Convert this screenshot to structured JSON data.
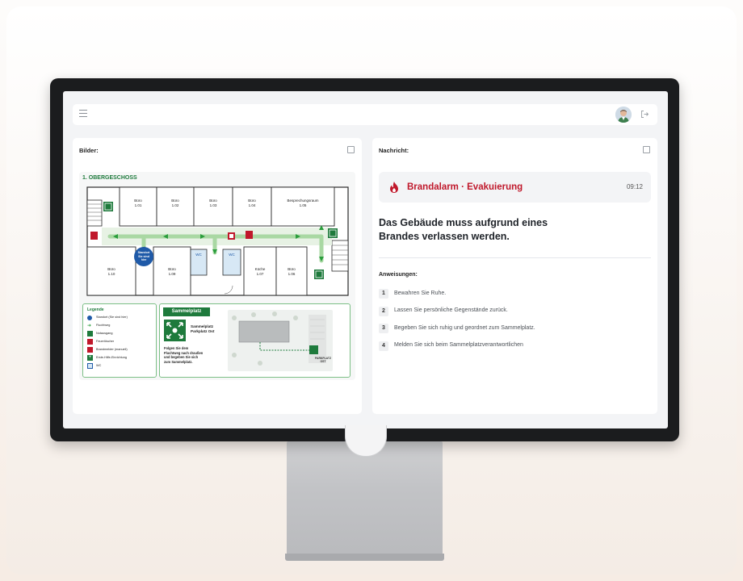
{
  "header": {
    "menu_icon": "hamburger-icon",
    "avatar_icon": "user-avatar",
    "logout_icon": "logout-icon"
  },
  "images_panel": {
    "title": "Bilder:",
    "plan": {
      "title": "1. OBERGESCHOSS",
      "rooms_top": [
        {
          "name": "Büro",
          "num": "1.01"
        },
        {
          "name": "Büro",
          "num": "1.02"
        },
        {
          "name": "Büro",
          "num": "1.03"
        },
        {
          "name": "Büro",
          "num": "1.04"
        },
        {
          "name": "Besprechungsraum",
          "num": "1.05"
        }
      ],
      "rooms_bottom": [
        {
          "name": "Büro",
          "num": "1.10"
        },
        {
          "name": "Büro",
          "num": "1.09"
        },
        {
          "name": "WC",
          "num": ""
        },
        {
          "name": "WC",
          "num": ""
        },
        {
          "name": "Küche",
          "num": "1.07"
        },
        {
          "name": "Büro",
          "num": "1.06"
        }
      ],
      "standort": [
        "Standort",
        "Sie sind",
        "hier"
      ],
      "legend": {
        "title": "Legende",
        "items": [
          "Standort (Sie sind hier)",
          "Fluchtweg",
          "Notausgang",
          "Feuerlöscher",
          "Brandmelder (manuell)",
          "Erste-Hilfe-Einrichtung",
          "WC"
        ]
      },
      "sammelplatz": {
        "title": "Sammelplatz",
        "name": [
          "Sammelplatz",
          "Parkplatz Ost"
        ],
        "desc": [
          "Folgen Sie dem",
          "Fluchtweg nach draußen",
          "und begeben Sie sich",
          "zum Sammelplatz."
        ],
        "map_label": [
          "PARKPLATZ",
          "OST"
        ]
      }
    }
  },
  "message_panel": {
    "title": "Nachricht:",
    "alarm_title": "Brandalarm · Evakuierung",
    "alarm_time": "09:12",
    "headline": [
      "Das Gebäude muss aufgrund eines",
      "Brandes verlassen werden."
    ],
    "instructions_title": "Anweisungen:",
    "instructions": [
      {
        "num": "1",
        "text": "Bewahren Sie Ruhe."
      },
      {
        "num": "2",
        "text": "Lassen Sie persönliche Gegenstände zurück."
      },
      {
        "num": "3",
        "text": "Begeben Sie sich ruhig und geordnet zum Sammelplatz."
      },
      {
        "num": "4",
        "text": "Melden Sie sich beim Sammelplatzverantwortlichen"
      }
    ]
  },
  "colors": {
    "alarm_red": "#c0182b",
    "escape_green": "#1e7a3c",
    "route_green": "#cfe9cc",
    "standort_blue": "#1f5aa8"
  }
}
